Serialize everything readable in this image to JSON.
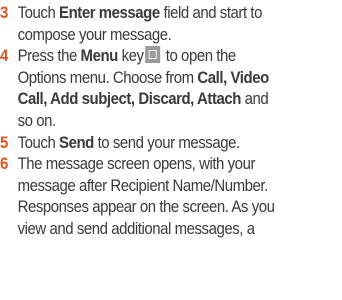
{
  "steps": [
    {
      "number": "3",
      "line1_pre": "Touch ",
      "line1_bold": "Enter message",
      "line1_post": " field and start to",
      "line2": "compose your message."
    },
    {
      "number": "4",
      "line1_pre": "Press the ",
      "line1_bold": "Menu",
      "line1_post": " key",
      "line1_post2": " to open the",
      "line2_pre": "Options menu. Choose from ",
      "line2_bold": "Call, Video",
      "line3_bold": "Call, Add subject, Discard, Attach",
      "line3_post": " and",
      "line4": "so on."
    },
    {
      "number": "5",
      "line1_pre": "Touch ",
      "line1_bold": "Send",
      "line1_post": " to send your message."
    },
    {
      "number": "6",
      "line1": "The message screen opens, with your",
      "line2": "message after Recipient Name/Number.",
      "line3": "Responses appear on the screen. As you",
      "line4": "view and send additional messages, a"
    }
  ],
  "icons": {
    "menu_key": "menu-key-icon"
  },
  "colors": {
    "step_number": "#e2541b",
    "text": "#3a3a3a",
    "icon_bg": "#9a9a9a"
  }
}
